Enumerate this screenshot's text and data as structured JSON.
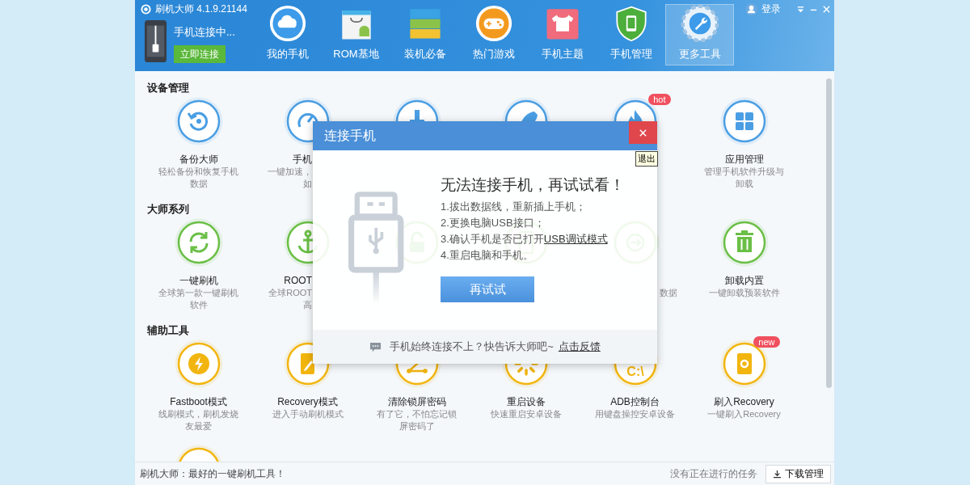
{
  "window": {
    "title": "刷机大师 4.1.9.21144",
    "login": "登录"
  },
  "device": {
    "status": "手机连接中...",
    "connect_button": "立即连接"
  },
  "nav": [
    {
      "label": "我的手机",
      "kind": "cloud",
      "selected": false
    },
    {
      "label": "ROM基地",
      "kind": "bag",
      "selected": false
    },
    {
      "label": "装机必备",
      "kind": "layers",
      "selected": false
    },
    {
      "label": "热门游戏",
      "kind": "gamepad",
      "selected": false
    },
    {
      "label": "手机主题",
      "kind": "shirt",
      "selected": false
    },
    {
      "label": "手机管理",
      "kind": "shield",
      "selected": false
    },
    {
      "label": "更多工具",
      "kind": "tools",
      "selected": true
    }
  ],
  "sections": [
    {
      "title": "设备管理",
      "color": "#4a9ee3",
      "items": [
        {
          "kind": "backup",
          "name": "备份大师",
          "desc": "轻松备份和恢复手机数据"
        },
        {
          "kind": "speed",
          "name": "手机",
          "desc_lines": [
            "一键加速，",
            "如"
          ]
        },
        {
          "kind": "brush"
        },
        {
          "kind": "rocket"
        },
        {
          "kind": "fire",
          "badge": "hot"
        },
        {
          "kind": "apps",
          "name": "应用管理",
          "desc": "管理手机软件升级与卸载"
        }
      ]
    },
    {
      "title": "大师系列",
      "color": "#6abf45",
      "items": [
        {
          "kind": "flash",
          "name": "一键刷机",
          "desc": "全球第一款一键刷机软件"
        },
        {
          "kind": "anchor",
          "name": "ROOT",
          "desc_lines": [
            "全球ROOT",
            "高"
          ]
        },
        {
          "kind": "unlock"
        },
        {
          "kind": "phone_plus"
        },
        {
          "kind": "move",
          "desc_lines": [
            "数据"
          ]
        },
        {
          "kind": "trash",
          "name": "卸载内置",
          "desc": "一键卸载预装软件"
        }
      ]
    },
    {
      "title": "辅助工具",
      "color": "#f2b50f",
      "items": [
        {
          "kind": "bolt",
          "name": "Fastboot模式",
          "desc": "线刷模式，刷机发烧友最爱"
        },
        {
          "kind": "pen",
          "name": "Recovery模式",
          "desc": "进入手动刷机模式"
        },
        {
          "kind": "pattern",
          "name": "清除锁屏密码",
          "desc": "有了它，不怕忘记锁屏密码了"
        },
        {
          "kind": "spinner",
          "name": "重启设备",
          "desc": "快速重启安卓设备"
        },
        {
          "kind": "cmd",
          "icon_text": "C:\\",
          "name": "ADB控制台",
          "desc": "用键盘操控安卓设备"
        },
        {
          "kind": "phone_gear",
          "name": "刷入Recovery",
          "desc": "一键刷入Recovery",
          "badge": "new"
        },
        {
          "kind": "plain"
        }
      ]
    }
  ],
  "dialog": {
    "title": "连接手机",
    "close_tooltip": "退出",
    "headline": "无法连接手机，再试试看！",
    "steps": [
      {
        "text": "1.拔出数据线，重新插上手机；"
      },
      {
        "text": "2.更换电脑USB接口；"
      },
      {
        "text": "3.确认手机是否已打开",
        "link": "USB调试模式"
      },
      {
        "text": "4.重启电脑和手机。"
      }
    ],
    "retry_button": "再试试",
    "footer_text": "手机始终连接不上？快告诉大师吧~",
    "footer_link": "点击反馈"
  },
  "status_bar": {
    "message": "刷机大师：最好的一键刷机工具！",
    "tasks": "没有正在进行的任务",
    "download_button": "下载管理"
  }
}
